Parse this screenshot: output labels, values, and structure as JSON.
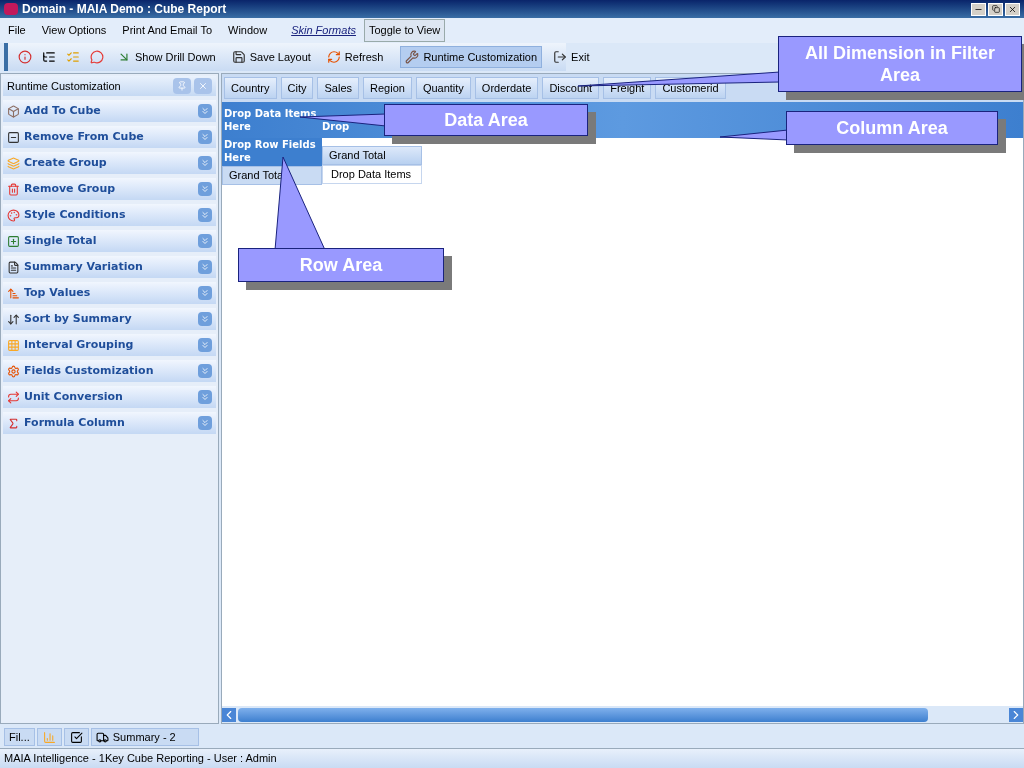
{
  "window": {
    "title": "Domain - MAIA Demo : Cube Report"
  },
  "menu": [
    "File",
    "View Options",
    "Print And Email To",
    "Window"
  ],
  "skin_formats": "Skin Formats",
  "toggle_view": "Toggle to View",
  "toolbar": [
    {
      "kind": "icon",
      "selected": false
    },
    {
      "kind": "icon",
      "selected": false
    },
    {
      "kind": "icon",
      "selected": false
    },
    {
      "kind": "icon",
      "selected": false
    },
    {
      "kind": "button",
      "label": "Show Drill Down",
      "selected": false
    },
    {
      "kind": "button",
      "label": "Save Layout",
      "selected": false
    },
    {
      "kind": "button",
      "label": "Refresh",
      "selected": false
    },
    {
      "kind": "separator"
    },
    {
      "kind": "button",
      "label": "Runtime Customization",
      "selected": true
    },
    {
      "kind": "button",
      "label": "Exit",
      "selected": false
    }
  ],
  "side_panel": {
    "title": "Runtime Customization",
    "items": [
      "Add To Cube",
      "Remove From Cube",
      "Create Group",
      "Remove Group",
      "Style Conditions",
      "Single Total",
      "Summary Variation",
      "Top Values",
      "Sort by Summary",
      "Interval Grouping",
      "Fields Customization",
      "Unit Conversion",
      "Formula Column"
    ]
  },
  "filter_fields": [
    "Country",
    "City",
    "Sales",
    "Region",
    "Quantity",
    "Orderdate",
    "Discount",
    "Freight",
    "Customerid"
  ],
  "pivot": {
    "data_drop": "Drop Data Items Here",
    "column_drop": "Drop",
    "row_drop": "Drop Row Fields Here",
    "row_total": "Grand Tota",
    "column_total": "Grand Total",
    "cell": "Drop Data Items"
  },
  "callouts": [
    "All Dimension in Filter Area",
    "Data Area",
    "Column Area",
    "Row Area"
  ],
  "bottom_tabs": [
    {
      "kind": "text",
      "label": "Fil..."
    },
    {
      "kind": "icon"
    },
    {
      "kind": "icon"
    },
    {
      "kind": "icon_text",
      "label": "Summary - 2"
    }
  ],
  "status_bar": "MAIA Intelligence - 1Key Cube Reporting - User : Admin"
}
